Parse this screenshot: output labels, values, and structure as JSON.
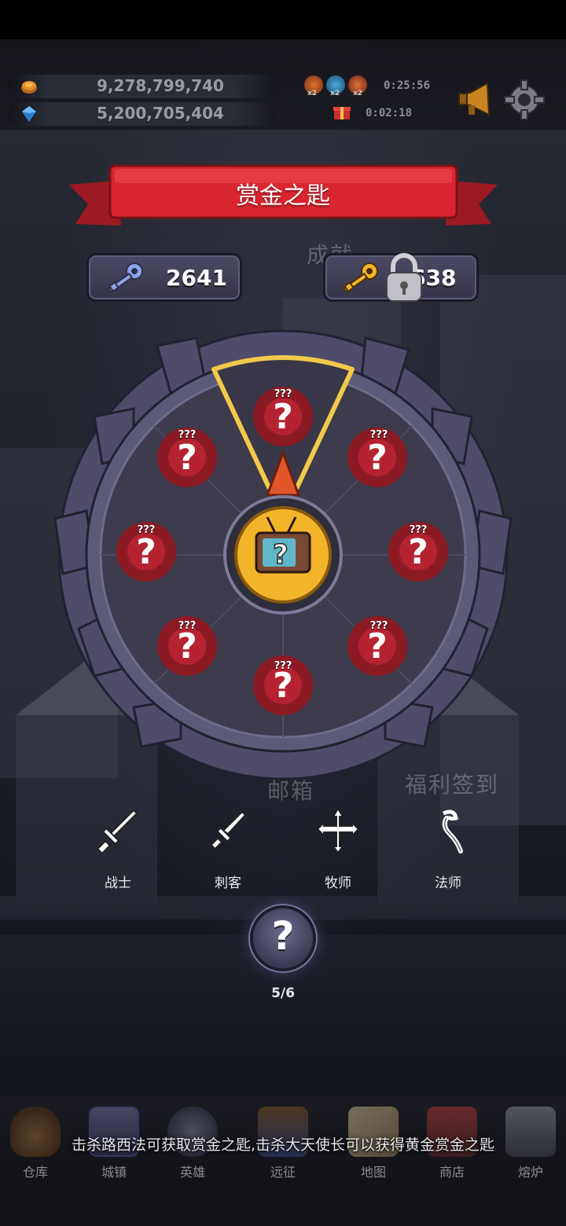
{
  "resources": {
    "gold": "9,278,799,740",
    "gems": "5,200,705,404"
  },
  "buffs": {
    "multiplier": "x2",
    "timer_main": "0:25:56",
    "timer_gift": "0:02:18"
  },
  "banner": {
    "title": "赏金之匙"
  },
  "keys": {
    "silver_count": "2641",
    "gold_count": "638"
  },
  "background_labels": {
    "achievement": "成就",
    "mailbox": "邮箱",
    "welfare": "福利签到"
  },
  "wheel": {
    "prize_label": "???",
    "prize_count": 8,
    "center_icon": "tv-ad-icon"
  },
  "classes": [
    {
      "label": "战士",
      "icon": "sword-icon"
    },
    {
      "label": "刺客",
      "icon": "dagger-icon"
    },
    {
      "label": "牧师",
      "icon": "holy-cross-icon"
    },
    {
      "label": "法师",
      "icon": "staff-icon"
    }
  ],
  "mystery": {
    "symbol": "?",
    "progress": "5/6"
  },
  "hint": "击杀路西法可获取赏金之匙,击杀大天使长可以获得黄金赏金之匙",
  "nav": [
    {
      "label": "仓库",
      "icon": "bag-icon"
    },
    {
      "label": "城镇",
      "icon": "castle-icon"
    },
    {
      "label": "英雄",
      "icon": "shield-icon"
    },
    {
      "label": "远征",
      "icon": "portal-icon"
    },
    {
      "label": "地图",
      "icon": "map-icon"
    },
    {
      "label": "商店",
      "icon": "shop-icon"
    },
    {
      "label": "熔炉",
      "icon": "anvil-icon"
    }
  ],
  "colors": {
    "banner_red": "#d8252f",
    "wheel_frame": "#4e4c6a",
    "wheel_inner": "#3d3b4c",
    "highlight_gold": "#f3c94a",
    "prize_red": "#8b1a23"
  }
}
